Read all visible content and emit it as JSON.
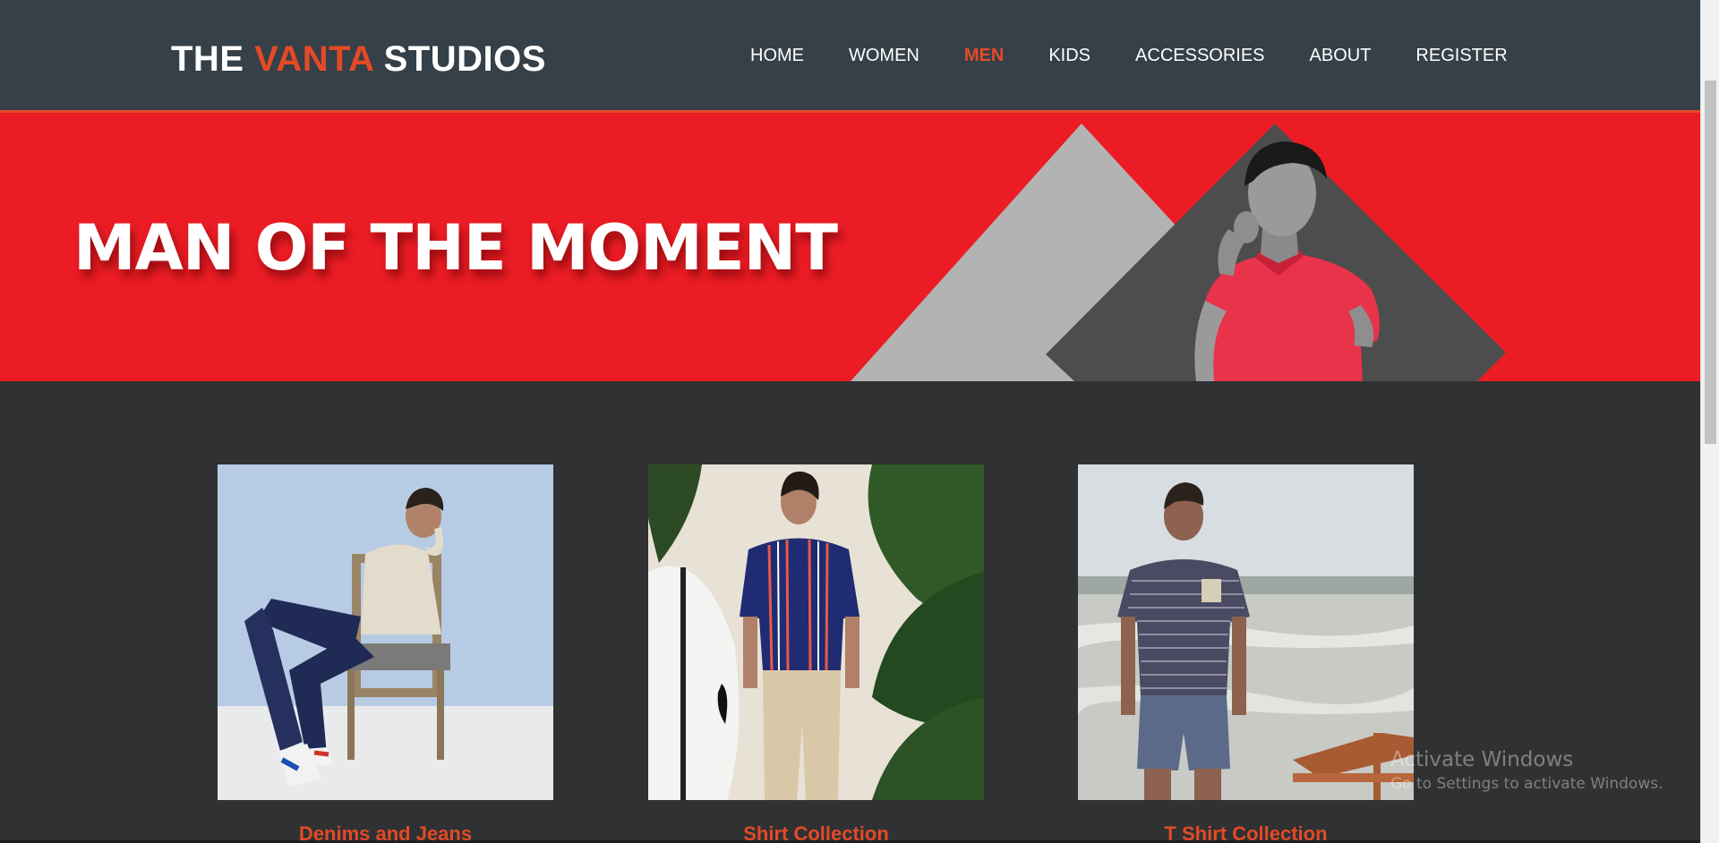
{
  "header": {
    "logo": {
      "part1": "THE ",
      "part2": "VANTA",
      "part3": " STUDIOS"
    },
    "nav": [
      {
        "label": "HOME",
        "active": false
      },
      {
        "label": "WOMEN",
        "active": false
      },
      {
        "label": "MEN",
        "active": true
      },
      {
        "label": "KIDS",
        "active": false
      },
      {
        "label": "ACCESSORIES",
        "active": false
      },
      {
        "label": "ABOUT",
        "active": false
      },
      {
        "label": "REGISTER",
        "active": false
      }
    ]
  },
  "hero": {
    "title": "MAN OF THE MOMENT"
  },
  "products": [
    {
      "label": "Denims and Jeans"
    },
    {
      "label": "Shirt Collection"
    },
    {
      "label": "T Shirt Collection"
    }
  ],
  "watermark": {
    "title": "Activate Windows",
    "subtitle": "Go to Settings to activate Windows."
  },
  "colors": {
    "header_bg": "#354048",
    "accent": "#e34a26",
    "hero_bg": "#ec1c24",
    "body_bg": "#303133"
  }
}
